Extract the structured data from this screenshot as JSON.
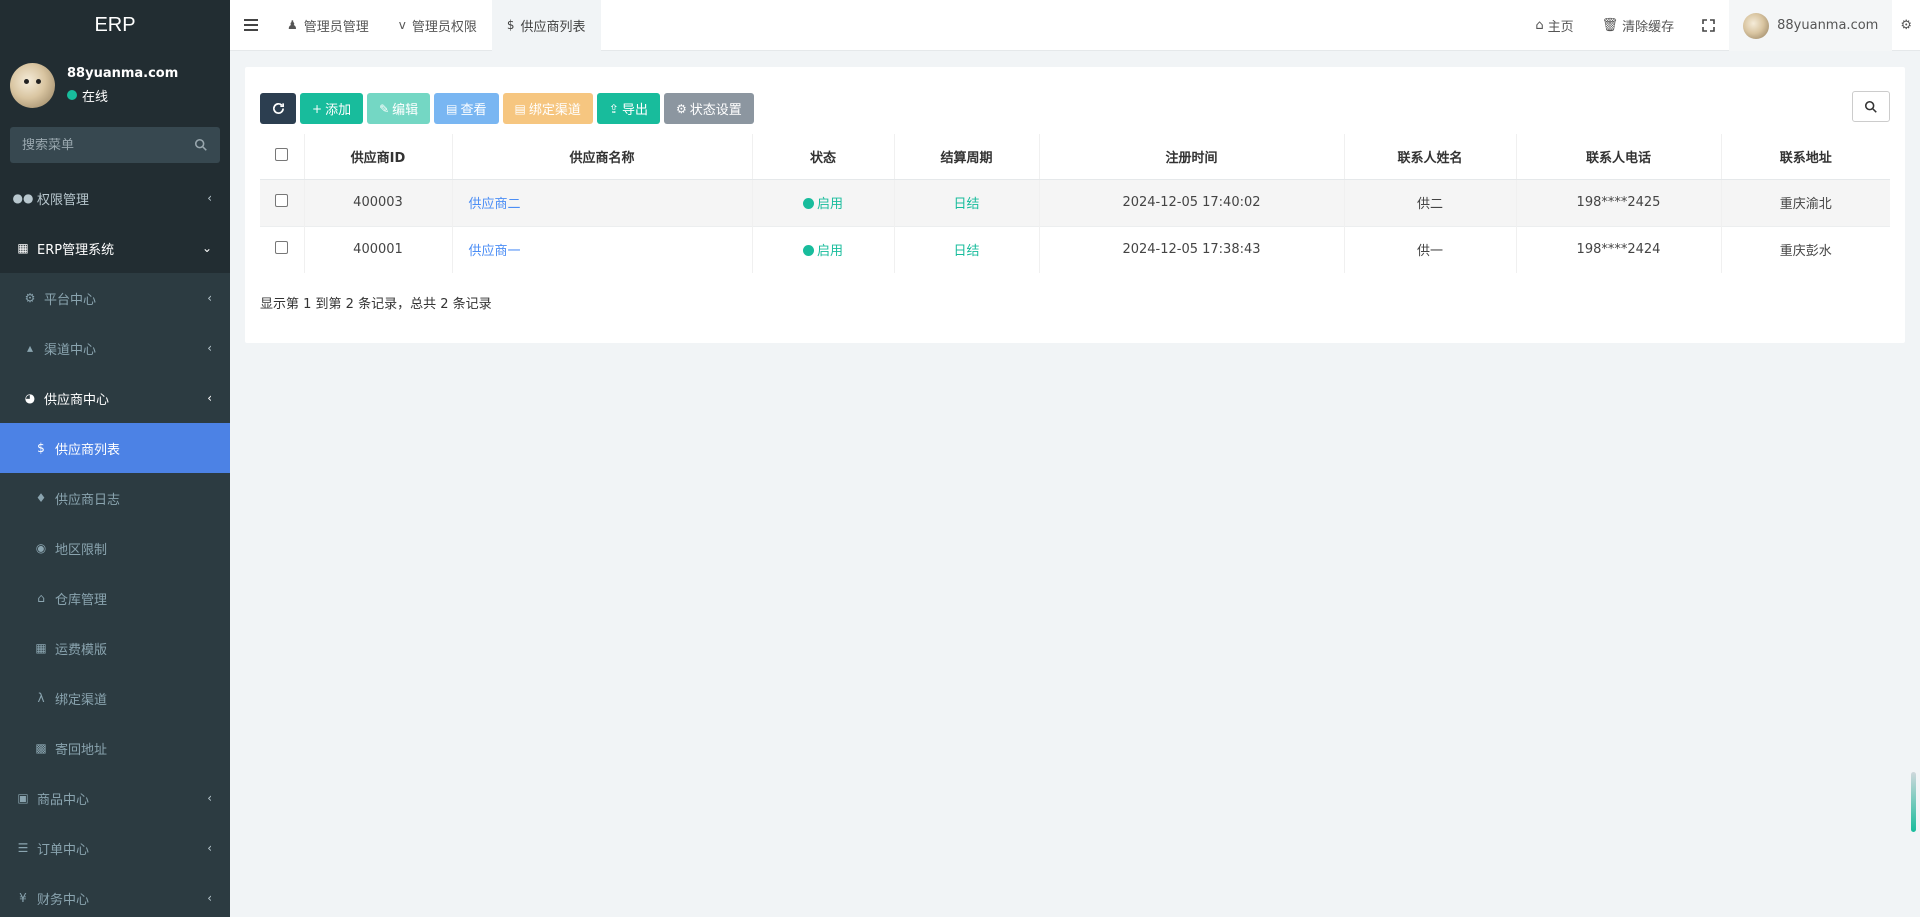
{
  "app": {
    "title": "ERP"
  },
  "user": {
    "name": "88yuanma.com",
    "status": "在线"
  },
  "sidebar": {
    "search_placeholder": "搜索菜单",
    "items": [
      {
        "label": "权限管理"
      },
      {
        "label": "ERP管理系统"
      },
      {
        "label": "平台中心"
      },
      {
        "label": "渠道中心"
      },
      {
        "label": "供应商中心"
      },
      {
        "label": "供应商列表"
      },
      {
        "label": "供应商日志"
      },
      {
        "label": "地区限制"
      },
      {
        "label": "仓库管理"
      },
      {
        "label": "运费模版"
      },
      {
        "label": "绑定渠道"
      },
      {
        "label": "寄回地址"
      },
      {
        "label": "商品中心"
      },
      {
        "label": "订单中心"
      },
      {
        "label": "财务中心"
      }
    ]
  },
  "topbar": {
    "tabs": [
      {
        "label": "管理员管理"
      },
      {
        "label": "管理员权限"
      },
      {
        "label": "供应商列表"
      }
    ],
    "home": "主页",
    "clear_cache": "清除缓存",
    "username": "88yuanma.com"
  },
  "toolbar": {
    "add": "添加",
    "edit": "编辑",
    "view": "查看",
    "bind": "绑定渠道",
    "export": "导出",
    "status": "状态设置"
  },
  "table": {
    "headers": [
      "供应商ID",
      "供应商名称",
      "状态",
      "结算周期",
      "注册时间",
      "联系人姓名",
      "联系人电话",
      "联系地址"
    ],
    "rows": [
      {
        "id": "400003",
        "name": "供应商二",
        "status": "启用",
        "cycle": "日结",
        "time": "2024-12-05 17:40:02",
        "contact": "供二",
        "phone": "198****2425",
        "address": "重庆渝北"
      },
      {
        "id": "400001",
        "name": "供应商一",
        "status": "启用",
        "cycle": "日结",
        "time": "2024-12-05 17:38:43",
        "contact": "供一",
        "phone": "198****2424",
        "address": "重庆彭水"
      }
    ]
  },
  "pager": {
    "text": "显示第 1 到第 2 条记录，总共 2 条记录"
  },
  "colors": {
    "sidebar": "#222d32",
    "active": "#4c82e5",
    "accent": "#18bc9c"
  }
}
